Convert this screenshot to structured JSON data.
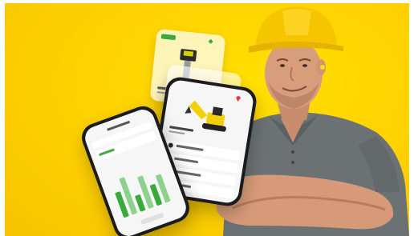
{
  "scene": {
    "background": "#ffd400",
    "description_text": ""
  },
  "apps": {
    "left_phone": {
      "header": "",
      "bars": [
        0.55,
        0.8,
        0.35,
        0.7,
        0.45,
        0.6
      ]
    },
    "right_phone": {
      "rows": [
        "",
        "",
        "",
        ""
      ]
    }
  },
  "colors": {
    "brand_yellow": "#ffd400",
    "helmet": "#f7c600",
    "shirt": "#6f7476",
    "skin": "#d79c7a",
    "accent_green": "#3ba93b",
    "accent_red": "#e2383f"
  }
}
